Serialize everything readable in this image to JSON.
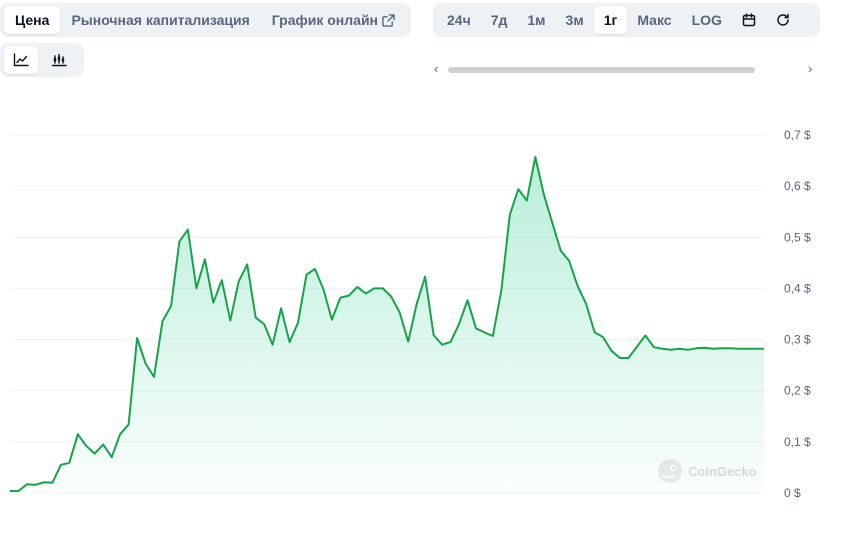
{
  "tabs_left": [
    {
      "label": "Цена",
      "active": true
    },
    {
      "label": "Рыночная капитализация",
      "active": false
    },
    {
      "label": "График онлайн",
      "active": false,
      "icon": "external-link-icon"
    }
  ],
  "tabs_right": [
    {
      "label": "24ч",
      "active": false
    },
    {
      "label": "7д",
      "active": false
    },
    {
      "label": "1м",
      "active": false
    },
    {
      "label": "3м",
      "active": false
    },
    {
      "label": "1г",
      "active": true
    },
    {
      "label": "Макс",
      "active": false
    },
    {
      "label": "LOG",
      "active": false
    }
  ],
  "tabs_right_icons": [
    "calendar-icon",
    "refresh-icon"
  ],
  "chart_types": [
    {
      "icon": "line-chart-icon",
      "active": true
    },
    {
      "icon": "candlestick-chart-icon",
      "active": false
    }
  ],
  "scroll": {
    "left_arrow": "‹",
    "right_arrow": "›"
  },
  "watermark": {
    "text": "CoinGecko"
  },
  "colors": {
    "line": "#16a34a",
    "fill_top": "#16c784",
    "grid": "#eff2f5",
    "accent": "#0d1421"
  },
  "chart_data": {
    "type": "area",
    "title": "",
    "xlabel": "",
    "ylabel": "",
    "ylim": [
      0,
      0.7
    ],
    "yticks": [
      0,
      0.1,
      0.2,
      0.3,
      0.4,
      0.5,
      0.6,
      0.7
    ],
    "ytick_labels": [
      "0 $",
      "0,1 $",
      "0,2 $",
      "0,3 $",
      "0,4 $",
      "0,5 $",
      "0,6 $",
      "0,7 $"
    ],
    "grid": true,
    "y_axis_position": "right",
    "x": [
      0,
      1,
      2,
      3,
      4,
      5,
      6,
      7,
      8,
      9,
      10,
      11,
      12,
      13,
      14,
      15,
      16,
      17,
      18,
      19,
      20,
      21,
      22,
      23,
      24,
      25,
      26,
      27,
      28,
      29,
      30,
      31,
      32,
      33,
      34,
      35,
      36,
      37,
      38,
      39,
      40,
      41,
      42,
      43,
      44,
      45,
      46,
      47,
      48,
      49,
      50,
      51,
      52,
      53,
      54,
      55,
      56,
      57,
      58,
      59,
      60,
      61,
      62,
      63,
      64,
      65,
      66,
      67,
      68,
      69,
      70,
      71,
      72,
      73,
      74,
      75,
      76,
      77,
      78,
      79,
      80,
      81,
      82,
      83,
      84,
      85,
      86,
      87,
      88,
      89
    ],
    "series": [
      {
        "values": [
          0.004,
          0.004,
          0.017,
          0.016,
          0.021,
          0.02,
          0.055,
          0.059,
          0.115,
          0.092,
          0.077,
          0.095,
          0.07,
          0.115,
          0.134,
          0.303,
          0.253,
          0.227,
          0.336,
          0.365,
          0.492,
          0.515,
          0.4,
          0.457,
          0.372,
          0.416,
          0.337,
          0.414,
          0.447,
          0.343,
          0.33,
          0.29,
          0.361,
          0.295,
          0.333,
          0.427,
          0.438,
          0.398,
          0.339,
          0.382,
          0.386,
          0.403,
          0.39,
          0.4,
          0.4,
          0.384,
          0.353,
          0.296,
          0.37,
          0.423,
          0.309,
          0.29,
          0.295,
          0.33,
          0.377,
          0.322,
          0.314,
          0.307,
          0.397,
          0.544,
          0.594,
          0.572,
          0.657,
          0.585,
          0.529,
          0.474,
          0.454,
          0.405,
          0.37,
          0.314,
          0.305,
          0.278,
          0.264,
          0.264,
          0.286,
          0.308,
          0.285,
          0.282,
          0.28,
          0.282,
          0.28,
          0.283,
          0.284,
          0.282,
          0.283,
          0.283,
          0.282,
          0.282,
          0.282,
          0.282
        ]
      }
    ]
  }
}
